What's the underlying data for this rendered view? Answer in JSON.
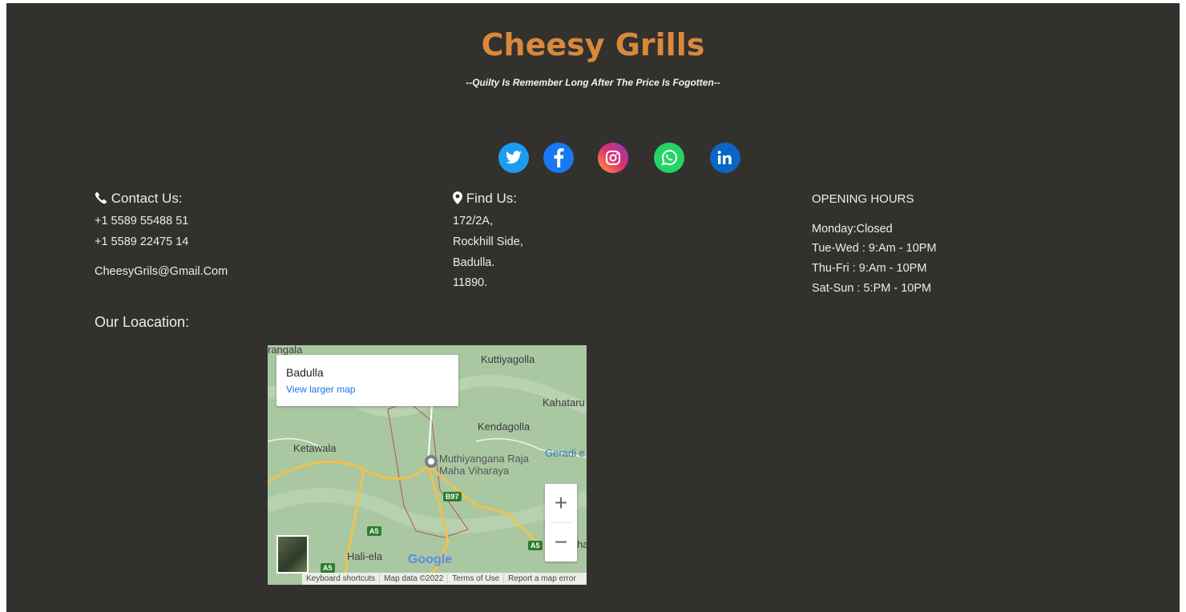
{
  "brand": {
    "name": "Cheesy Grills",
    "tagline": "--Quilty Is Remember Long After The Price Is Fogotten--"
  },
  "social": [
    {
      "name": "twitter-icon",
      "color": "#1d9bf0"
    },
    {
      "name": "facebook-icon",
      "color": "#1877f2"
    },
    {
      "name": "instagram-icon",
      "color": "#e1306c"
    },
    {
      "name": "whatsapp-icon",
      "color": "#25d366"
    },
    {
      "name": "linkedin-icon",
      "color": "#0a66c2"
    }
  ],
  "contact": {
    "heading": "Contact Us:",
    "phone1": "+1 5589 55488 51",
    "phone2": "+1 5589 22475 14",
    "email": "CheesyGrils@Gmail.Com"
  },
  "find": {
    "heading": "Find Us:",
    "address": [
      "172/2A,",
      "Rockhill Side,",
      "Badulla.",
      "11890."
    ]
  },
  "hours": {
    "heading": "OPENING HOURS",
    "rows": [
      "Monday:Closed",
      "Tue-Wed : 9:Am - 10PM",
      "Thu-Fri : 9:Am - 10PM",
      "Sat-Sun : 5:PM - 10PM"
    ]
  },
  "location": {
    "heading": "Our Loacation:",
    "map": {
      "card_title": "Badulla",
      "card_link": "View larger map",
      "places": {
        "p1": "rangala",
        "p2": "Kuttiyagolla",
        "p3": "Kahataru",
        "p4": "Kendagolla",
        "p5": "Ketawala",
        "p6": "Geradi e",
        "p7a": "Muthiyangana Raja",
        "p7b": "Maha Viharaya",
        "p8": "Hali-ela",
        "p9": "ha"
      },
      "shields": {
        "b97": "B97",
        "a5a": "A5",
        "a5b": "A5",
        "a5c": "A5"
      },
      "zoom_in": "+",
      "zoom_out": "−",
      "google": "Google",
      "attribution": [
        "Keyboard shortcuts",
        "Map data ©2022",
        "Terms of Use",
        "Report a map error"
      ]
    }
  }
}
